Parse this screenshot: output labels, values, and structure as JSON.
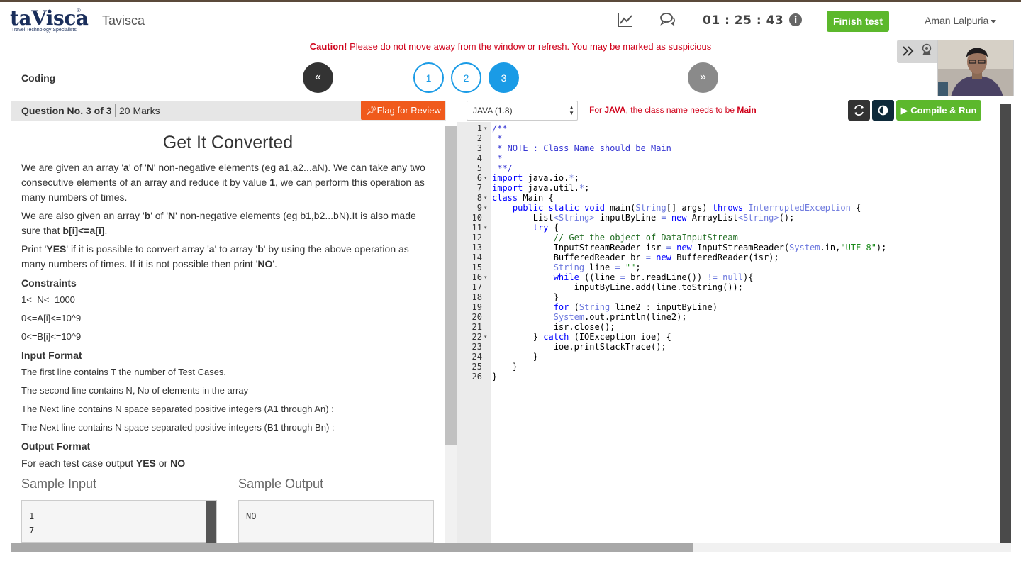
{
  "header": {
    "logo_text": "taVisca",
    "logo_reg": "®",
    "logo_tagline": "Travel Technology Specialists",
    "brand": "Tavisca",
    "timer": "01 : 25 : 43",
    "finish_label": "Finish test",
    "user_name": "Aman Lalpuria",
    "icons": [
      "chart-icon",
      "chat-icon",
      "info-icon"
    ]
  },
  "caution": {
    "bold": "Caution!",
    "text": " Please do not move away from the window or refresh. You may be marked as suspicious"
  },
  "nav": {
    "section": "Coding",
    "prev": "«",
    "next": "»",
    "questions": [
      "1",
      "2",
      "3"
    ],
    "active_question": "3"
  },
  "camera": {
    "icons": [
      "double-chevron-right-icon",
      "webcam-icon"
    ]
  },
  "question": {
    "number": "Question No. 3 of 3",
    "marks": "20 Marks",
    "flag_label": "Flag for Review",
    "title": "Get It Converted",
    "p1_a": "We are given an array '",
    "p1_b": "a",
    "p1_c": "' of '",
    "p1_d": "N",
    "p1_e": "' non-negative elements (eg a1,a2...aN). We can take any two consecutive elements of an array and reduce it by value ",
    "p1_f": "1",
    "p1_g": ", we can perform this operation as many numbers of times.",
    "p2_a": "We are also given an array '",
    "p2_b": "b",
    "p2_c": "' of '",
    "p2_d": "N",
    "p2_e": "' non-negative elements (eg b1,b2...bN).It is also made sure that ",
    "p2_f": "b[i]<=a[i]",
    "p2_g": ".",
    "p3_a": "Print '",
    "p3_b": "YES",
    "p3_c": "' if it is possible to convert array '",
    "p3_d": "a",
    "p3_e": "' to array '",
    "p3_f": "b",
    "p3_g": "' by using the above operation as many numbers of times. If it is not possible then print '",
    "p3_h": "NO",
    "p3_i": "'.",
    "constraints_head": "Constraints",
    "constraints": [
      "1<=N<=1000",
      "0<=A[i]<=10^9",
      "0<=B[i]<=10^9"
    ],
    "input_head": "Input Format",
    "input_lines": [
      "The first line contains T the number of Test Cases.",
      "The second line contains N, No of elements in the array",
      "The Next line contains N space separated positive integers (A1 through An) :",
      "The Next line contains N space separated positive integers (B1 through Bn) :"
    ],
    "output_head": "Output Format",
    "output_a": "For each test case output ",
    "output_b": "YES",
    "output_c": " or ",
    "output_d": "NO",
    "sample_input_head": "Sample Input",
    "sample_output_head": "Sample Output",
    "sample_input": [
      "1",
      "7"
    ],
    "sample_output": [
      "NO"
    ]
  },
  "editor": {
    "language": "JAVA (1.8)",
    "note_a": "For ",
    "note_b": "JAVA",
    "note_c": ", the class name needs to be ",
    "note_d": "Main",
    "compile_label": "Compile & Run",
    "line_numbers": [
      "1",
      "2",
      "3",
      "4",
      "5",
      "6",
      "7",
      "8",
      "9",
      "10",
      "11",
      "12",
      "13",
      "14",
      "15",
      "16",
      "17",
      "18",
      "19",
      "20",
      "21",
      "22",
      "23",
      "24",
      "25",
      "26"
    ],
    "fold_lines": [
      1,
      6,
      8,
      9,
      11,
      16,
      22
    ],
    "code": [
      [
        [
          "doc",
          "/**"
        ]
      ],
      [
        [
          "doc",
          " *"
        ]
      ],
      [
        [
          "doc",
          " * NOTE : Class Name should be Main"
        ]
      ],
      [
        [
          "doc",
          " *"
        ]
      ],
      [
        [
          "doc",
          " **/"
        ]
      ],
      [
        [
          "kw",
          "import"
        ],
        [
          "",
          " java.io."
        ],
        [
          "ty",
          "*"
        ],
        [
          "",
          ";"
        ]
      ],
      [
        [
          "kw",
          "import"
        ],
        [
          "",
          " java.util."
        ],
        [
          "ty",
          "*"
        ],
        [
          "",
          ";"
        ]
      ],
      [
        [
          "kw",
          "class"
        ],
        [
          "",
          " Main {"
        ]
      ],
      [
        [
          "",
          "    "
        ],
        [
          "kw",
          "public"
        ],
        [
          "",
          " "
        ],
        [
          "kw",
          "static"
        ],
        [
          "",
          " "
        ],
        [
          "kw",
          "void"
        ],
        [
          "",
          " main("
        ],
        [
          "ty",
          "String"
        ],
        [
          "",
          "[] args) "
        ],
        [
          "kw",
          "throws"
        ],
        [
          "",
          " "
        ],
        [
          "ty",
          "InterruptedException"
        ],
        [
          "",
          " {"
        ]
      ],
      [
        [
          "",
          "        List"
        ],
        [
          "ty",
          "<String>"
        ],
        [
          "",
          " inputByLine "
        ],
        [
          "ty",
          "="
        ],
        [
          "",
          " "
        ],
        [
          "kw",
          "new"
        ],
        [
          "",
          " ArrayList"
        ],
        [
          "ty",
          "<String>"
        ],
        [
          "",
          "();"
        ]
      ],
      [
        [
          "",
          "        "
        ],
        [
          "kw",
          "try"
        ],
        [
          "",
          " {"
        ]
      ],
      [
        [
          "",
          "            "
        ],
        [
          "com",
          "// Get the object of DataInputStream"
        ]
      ],
      [
        [
          "",
          "            InputStreamReader isr "
        ],
        [
          "ty",
          "="
        ],
        [
          "",
          " "
        ],
        [
          "kw",
          "new"
        ],
        [
          "",
          " InputStreamReader("
        ],
        [
          "ty",
          "System"
        ],
        [
          "",
          ".in,"
        ],
        [
          "str",
          "\"UTF-8\""
        ],
        [
          "",
          ");"
        ]
      ],
      [
        [
          "",
          "            BufferedReader br "
        ],
        [
          "ty",
          "="
        ],
        [
          "",
          " "
        ],
        [
          "kw",
          "new"
        ],
        [
          "",
          " BufferedReader(isr);"
        ]
      ],
      [
        [
          "",
          "            "
        ],
        [
          "ty",
          "String"
        ],
        [
          "",
          " line "
        ],
        [
          "ty",
          "="
        ],
        [
          "",
          " "
        ],
        [
          "str",
          "\"\""
        ],
        [
          "",
          ";"
        ]
      ],
      [
        [
          "",
          "            "
        ],
        [
          "kw",
          "while"
        ],
        [
          "",
          " ((line "
        ],
        [
          "ty",
          "="
        ],
        [
          "",
          " br.readLine()) "
        ],
        [
          "ty",
          "!="
        ],
        [
          "",
          " "
        ],
        [
          "ty",
          "null"
        ],
        [
          "",
          "){"
        ]
      ],
      [
        [
          "",
          "                inputByLine.add(line.toString());"
        ]
      ],
      [
        [
          "",
          "            }"
        ]
      ],
      [
        [
          "",
          "            "
        ],
        [
          "kw",
          "for"
        ],
        [
          "",
          " ("
        ],
        [
          "ty",
          "String"
        ],
        [
          "",
          " line2 : inputByLine)"
        ]
      ],
      [
        [
          "",
          "            "
        ],
        [
          "ty",
          "System"
        ],
        [
          "",
          ".out.println(line2);"
        ]
      ],
      [
        [
          "",
          "            isr.close();"
        ]
      ],
      [
        [
          "",
          "        } "
        ],
        [
          "kw",
          "catch"
        ],
        [
          "",
          " (IOException ioe) {"
        ]
      ],
      [
        [
          "",
          "            ioe.printStackTrace();"
        ]
      ],
      [
        [
          "",
          "        }"
        ]
      ],
      [
        [
          "",
          "    }"
        ]
      ],
      [
        [
          "",
          "}"
        ]
      ]
    ]
  },
  "colors": {
    "accent_green": "#5cb82c",
    "question_blue": "#1a9be6",
    "flag_orange": "#f05a1c",
    "warning_red": "#d0021b"
  }
}
